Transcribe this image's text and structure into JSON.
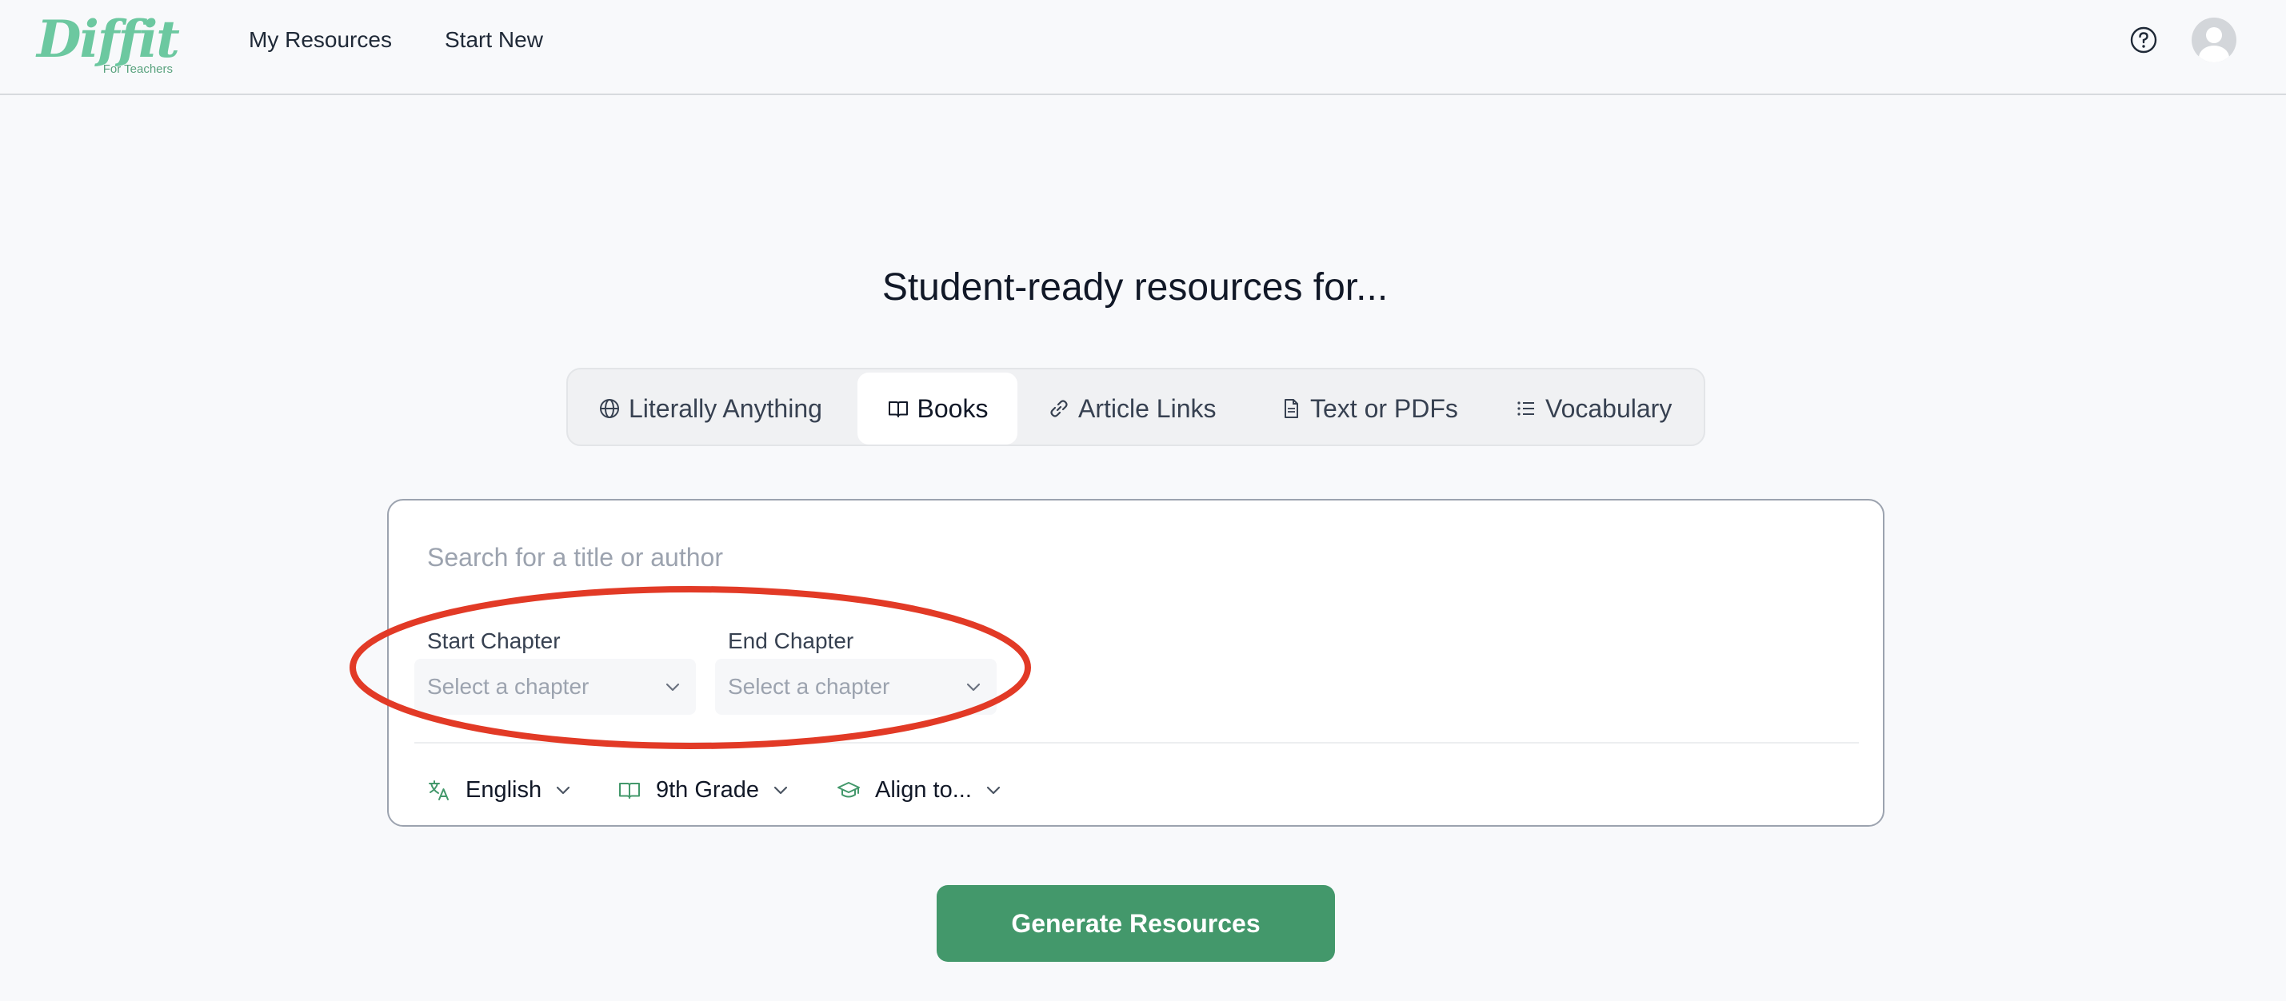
{
  "header": {
    "logo_text": "Diffit",
    "logo_subtitle": "For Teachers",
    "nav": [
      {
        "label": "My Resources"
      },
      {
        "label": "Start New"
      }
    ],
    "help_icon": "help-circle-icon",
    "avatar_icon": "user-avatar-icon"
  },
  "main": {
    "headline": "Student-ready resources for...",
    "tabs": [
      {
        "label": "Literally Anything",
        "icon": "globe-icon",
        "active": false
      },
      {
        "label": "Books",
        "icon": "book-open-icon",
        "active": true
      },
      {
        "label": "Article Links",
        "icon": "link-icon",
        "active": false
      },
      {
        "label": "Text or PDFs",
        "icon": "file-text-icon",
        "active": false
      },
      {
        "label": "Vocabulary",
        "icon": "list-icon",
        "active": false
      }
    ],
    "search": {
      "placeholder": "Search for a title or author",
      "value": ""
    },
    "start_chapter": {
      "label": "Start Chapter",
      "placeholder": "Select a chapter"
    },
    "end_chapter": {
      "label": "End Chapter",
      "placeholder": "Select a chapter"
    },
    "options": {
      "language": {
        "value": "English",
        "icon": "translate-icon"
      },
      "grade": {
        "value": "9th Grade",
        "icon": "book-icon"
      },
      "align": {
        "value": "Align to...",
        "icon": "graduation-cap-icon"
      }
    },
    "generate_label": "Generate Resources"
  },
  "colors": {
    "brand_green": "#43986b",
    "logo_green": "#6cc8a0",
    "annotation_red": "#e23a26"
  }
}
